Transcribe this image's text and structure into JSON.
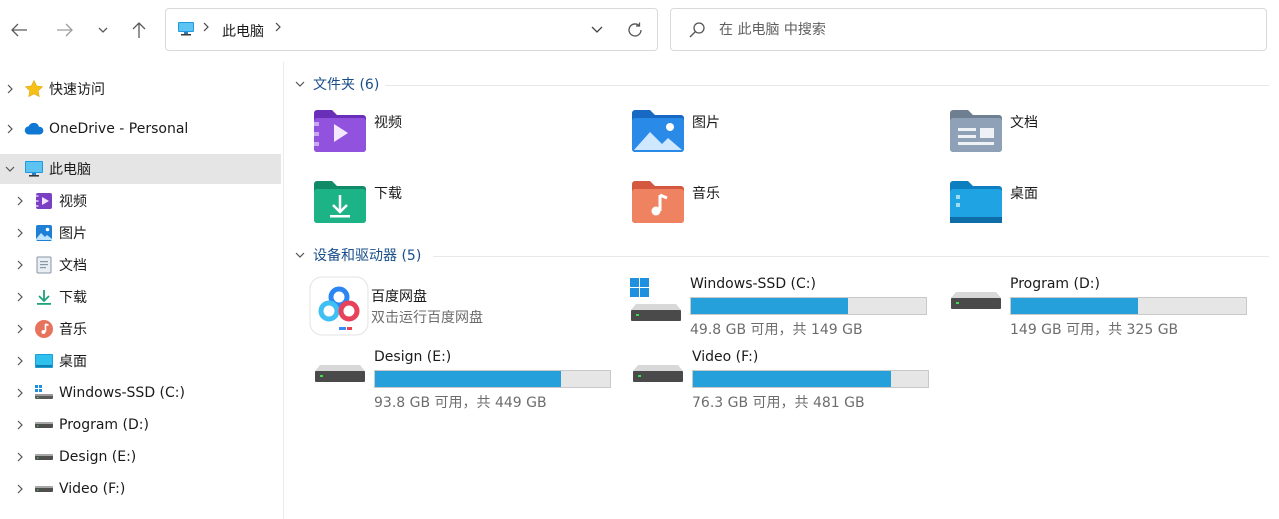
{
  "toolbar": {
    "back_icon": "arrow-left-icon",
    "forward_icon": "arrow-right-icon",
    "recent_icon": "chevron-down-icon",
    "up_icon": "arrow-up-icon"
  },
  "address": {
    "location": "此电脑",
    "dropdown_icon": "chevron-down-icon",
    "refresh_icon": "refresh-icon"
  },
  "search": {
    "placeholder": "在 此电脑 中搜索"
  },
  "sidebar": {
    "items": [
      {
        "label": "快速访问",
        "icon": "star-icon",
        "level": 0
      },
      {
        "label": "OneDrive - Personal",
        "icon": "cloud-icon",
        "level": 0
      },
      {
        "label": "此电脑",
        "icon": "monitor-icon",
        "level": 0,
        "expanded": true,
        "selected": true
      },
      {
        "label": "视频",
        "icon": "video-folder-icon",
        "level": 1
      },
      {
        "label": "图片",
        "icon": "pictures-folder-icon",
        "level": 1
      },
      {
        "label": "文档",
        "icon": "document-icon",
        "level": 1
      },
      {
        "label": "下载",
        "icon": "download-icon",
        "level": 1
      },
      {
        "label": "音乐",
        "icon": "music-icon",
        "level": 1
      },
      {
        "label": "桌面",
        "icon": "desktop-icon",
        "level": 1
      },
      {
        "label": "Windows-SSD (C:)",
        "icon": "windows-drive-icon",
        "level": 1
      },
      {
        "label": "Program (D:)",
        "icon": "drive-icon",
        "level": 1
      },
      {
        "label": "Design (E:)",
        "icon": "drive-icon",
        "level": 1
      },
      {
        "label": "Video (F:)",
        "icon": "drive-icon",
        "level": 1
      }
    ]
  },
  "folders_section": {
    "title": "文件夹 (6)",
    "items": [
      {
        "name": "视频",
        "icon": "video-folder-icon"
      },
      {
        "name": "图片",
        "icon": "pictures-folder-icon"
      },
      {
        "name": "文档",
        "icon": "documents-folder-icon"
      },
      {
        "name": "下载",
        "icon": "downloads-folder-icon"
      },
      {
        "name": "音乐",
        "icon": "music-folder-icon"
      },
      {
        "name": "桌面",
        "icon": "desktop-folder-icon"
      }
    ]
  },
  "devices_section": {
    "title": "设备和驱动器 (5)",
    "app": {
      "name": "百度网盘",
      "subtitle": "双击运行百度网盘",
      "icon": "baidu-netdisk-icon"
    },
    "drives": [
      {
        "name": "Windows-SSD (C:)",
        "info": "49.8 GB 可用，共 149 GB",
        "free_gb": 49.8,
        "total_gb": 149,
        "icon": "windows-drive-icon"
      },
      {
        "name": "Program (D:)",
        "info": "149 GB 可用，共 325 GB",
        "free_gb": 149,
        "total_gb": 325,
        "icon": "drive-icon"
      },
      {
        "name": "Design (E:)",
        "info": "93.8 GB 可用，共 449 GB",
        "free_gb": 93.8,
        "total_gb": 449,
        "icon": "drive-icon"
      },
      {
        "name": "Video (F:)",
        "info": "76.3 GB 可用，共 481 GB",
        "free_gb": 76.3,
        "total_gb": 481,
        "icon": "drive-icon"
      }
    ]
  },
  "colors": {
    "accent": "#26a0da",
    "section_title": "#1a4e8a",
    "selected_bg": "#e5e5e5"
  }
}
